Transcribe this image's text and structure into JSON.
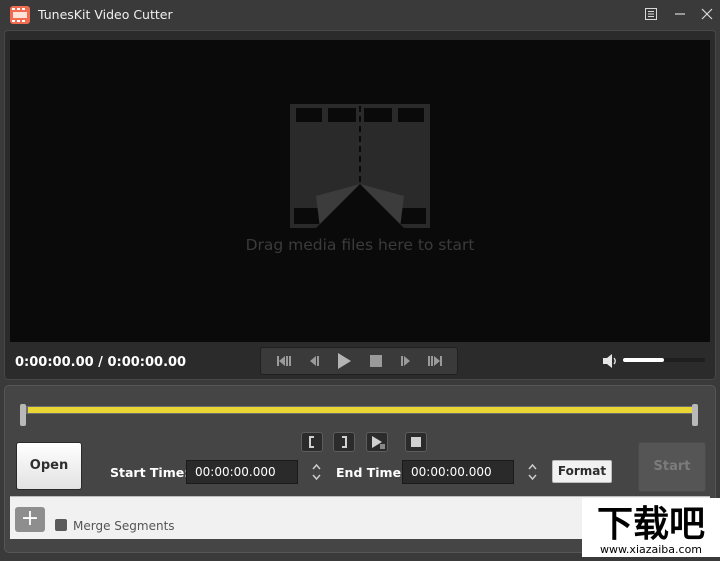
{
  "app": {
    "title": "TunesKit Video Cutter"
  },
  "window_controls": {
    "menu": "menu-icon",
    "minimize": "minimize-icon",
    "close": "close-icon"
  },
  "player": {
    "drop_hint": "Drag media files here to start",
    "timecode": "0:00:00.00 / 0:00:00.00",
    "transport_icons": [
      "previous-frame-icon",
      "step-back-icon",
      "play-icon",
      "stop-icon",
      "step-forward-icon",
      "next-frame-icon"
    ],
    "volume_level": 0.5
  },
  "editor": {
    "segment_icons": [
      "mark-in-icon",
      "mark-out-icon",
      "preview-segment-icon",
      "stop-preview-icon"
    ],
    "open_label": "Open",
    "start_time_label": "Start Time:",
    "start_time_value": "00:00:00.000",
    "end_time_label": "End Time:",
    "end_time_value": "00:00:00.000",
    "format_label": "Format",
    "start_label": "Start"
  },
  "segments": {
    "add_label": "+",
    "merge_label": "Merge Segments"
  },
  "watermark": {
    "text": "下载吧",
    "url": "www.xiazaiba.com"
  },
  "colors": {
    "timeline": "#e9d533",
    "background": "#3a3a3a",
    "video": "#0a0a0a"
  }
}
